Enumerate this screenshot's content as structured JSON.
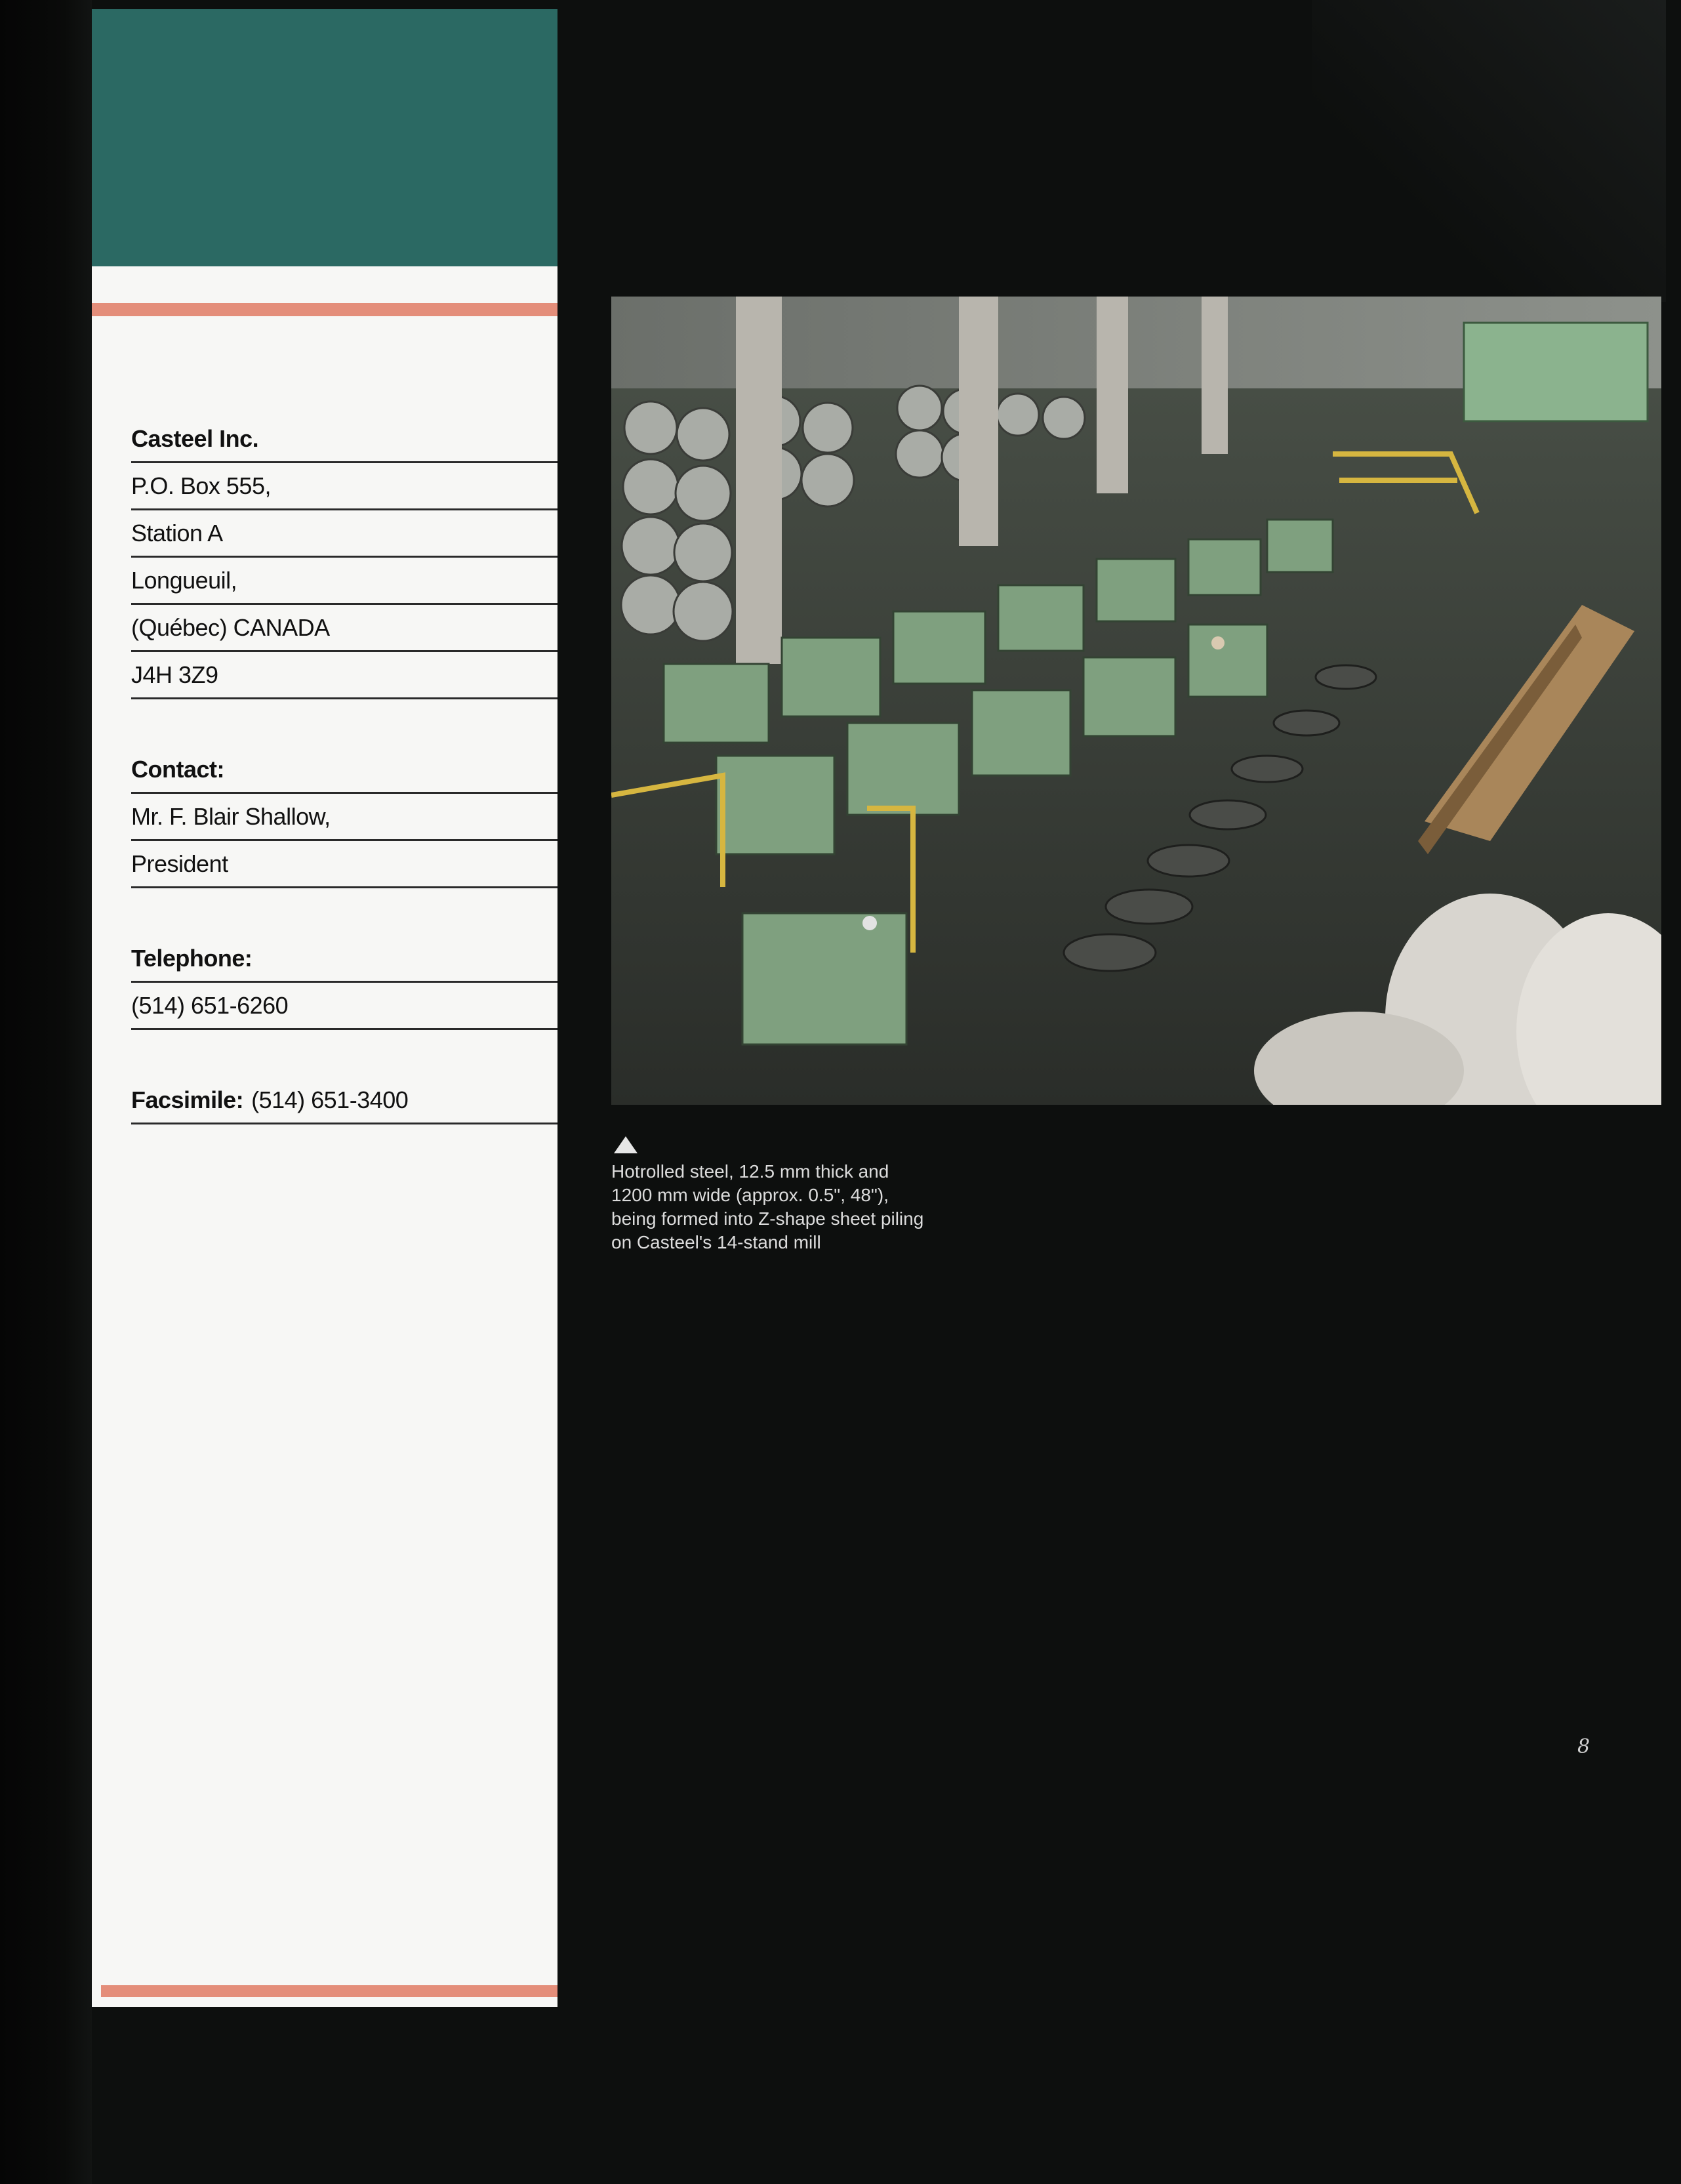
{
  "contact": {
    "company": "Casteel Inc.",
    "address_line1": "P.O. Box 555,",
    "address_line2": "Station A",
    "address_line3": "Longueuil,",
    "address_line4": "(Québec) CANADA",
    "postal_code": "J4H 3Z9",
    "contact_label": "Contact:",
    "contact_name": "Mr. F. Blair Shallow,",
    "contact_title": "President",
    "telephone_label": "Telephone:",
    "telephone": "(514) 651-6260",
    "facsimile_label": "Facsimile:",
    "facsimile": "(514) 651-3400"
  },
  "caption": {
    "line1": "Hotrolled steel, 12.5 mm thick and",
    "line2": "1200 mm wide (approx. 0.5\", 48\"),",
    "line3": "being formed into Z-shape sheet piling",
    "line4": "on Casteel's 14-stand mill"
  },
  "page_number": "8",
  "colors": {
    "teal": "#2b6963",
    "salmon": "#e48e7a",
    "background": "#0d0f0e"
  }
}
